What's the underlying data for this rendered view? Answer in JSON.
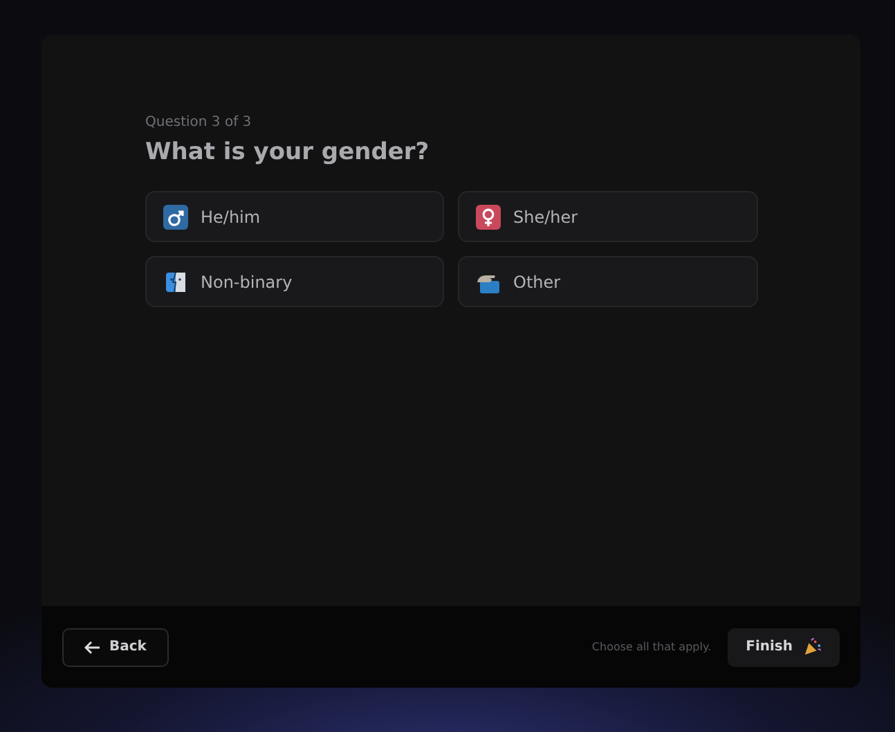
{
  "question": {
    "progress": "Question 3 of 3",
    "title": "What is your gender?"
  },
  "options": [
    {
      "label": "He/him",
      "kind": "male",
      "selected": false
    },
    {
      "label": "She/her",
      "kind": "female",
      "selected": false
    },
    {
      "label": "Non-binary",
      "kind": "nonbinary",
      "selected": false
    },
    {
      "label": "Other",
      "kind": "other",
      "selected": false
    }
  ],
  "footer": {
    "back": "Back",
    "hint": "Choose all that apply.",
    "finish": "Finish"
  }
}
